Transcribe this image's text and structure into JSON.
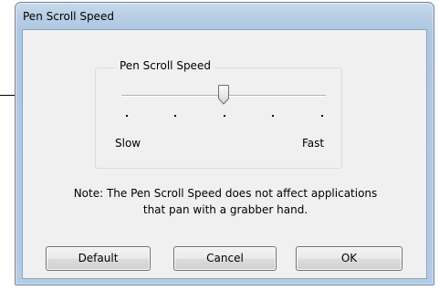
{
  "window": {
    "title": "Pen Scroll Speed"
  },
  "group": {
    "label": "Pen Scroll Speed"
  },
  "slider": {
    "min_label": "Slow",
    "max_label": "Fast",
    "tick_count": 5,
    "value_fraction": 0.5
  },
  "note": {
    "line1": "Note: The Pen Scroll Speed does not affect applications",
    "line2": "that pan with a grabber hand."
  },
  "buttons": {
    "default_label": "Default",
    "cancel_label": "Cancel",
    "ok_label": "OK"
  }
}
